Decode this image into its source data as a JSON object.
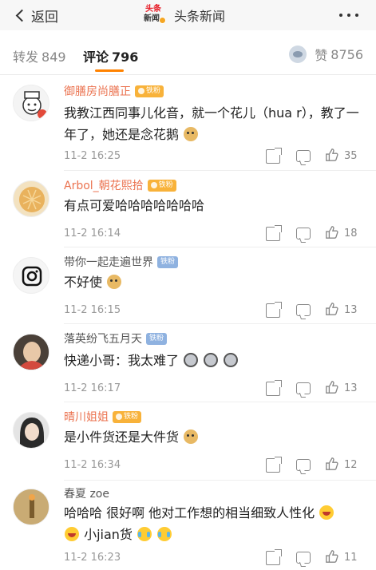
{
  "nav": {
    "back_label": "返回",
    "logo_line1": "头条",
    "logo_line2": "新闻",
    "app_name": "头条新闻"
  },
  "tabs": {
    "repost_label": "转发",
    "repost_count": "849",
    "comment_label": "评论",
    "comment_count": "796",
    "like_label": "赞",
    "like_count": "8756"
  },
  "accent_color": "#ff8200",
  "comments": [
    {
      "user": "御膳房尚膳正",
      "badge": "铁粉",
      "text": "我教江西同事儿化音，就一个花儿（hua r），教了一年了，她还是念花鹅",
      "emoji": [
        "doge"
      ],
      "time": "11-2 16:25",
      "likes": "35"
    },
    {
      "user": "Arbol_朝花熙拾",
      "badge": "铁粉",
      "text": "有点可爱哈哈哈哈哈哈哈",
      "emoji": [],
      "time": "11-2 16:14",
      "likes": "18"
    },
    {
      "user": "带你一起走遍世界",
      "badge": "铁粉",
      "text": "不好使",
      "emoji": [
        "doge"
      ],
      "time": "11-2 16:15",
      "likes": "13"
    },
    {
      "user": "落英纷飞五月天",
      "badge": "铁粉",
      "text": "快递小哥：我太难了",
      "emoji": [
        "husky",
        "husky",
        "husky"
      ],
      "time": "11-2 16:17",
      "likes": "13"
    },
    {
      "user": "晴川姐姐",
      "badge": "铁粉",
      "text": "是小件货还是大件货",
      "emoji": [
        "doge"
      ],
      "time": "11-2 16:34",
      "likes": "12"
    },
    {
      "user": "春夏 zoe",
      "text_line1": "哈哈哈 很好啊 他对工作想的相当细致人性化",
      "text_line2": "小jian货",
      "time": "11-2 16:23",
      "likes": "11"
    }
  ]
}
